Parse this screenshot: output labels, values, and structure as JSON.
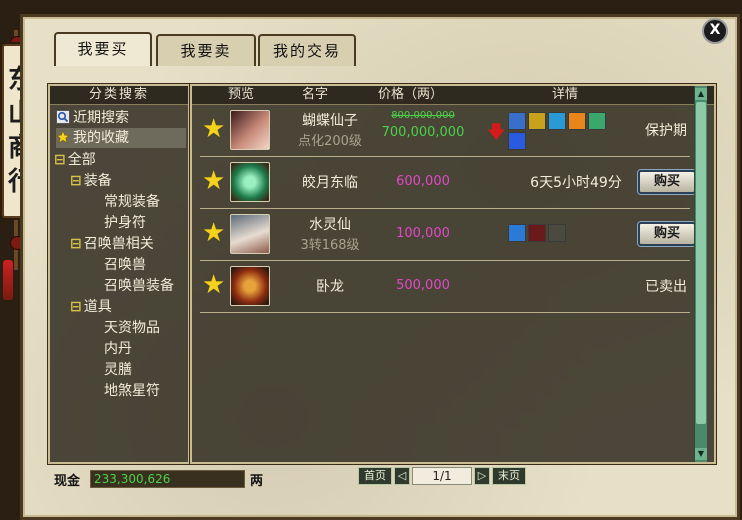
{
  "sign": {
    "chars": [
      "东",
      "山",
      "商",
      "行"
    ]
  },
  "close_label": "X",
  "tabs": [
    {
      "label": "我要买",
      "active": true
    },
    {
      "label": "我要卖",
      "active": false
    },
    {
      "label": "我的交易",
      "active": false
    }
  ],
  "left_panel": {
    "header": "分类搜索",
    "items": [
      {
        "label": "近期搜索",
        "icon": "search-icon"
      },
      {
        "label": "我的收藏",
        "icon": "star-icon",
        "selected": true
      },
      {
        "label": "全部",
        "expander": "⊟"
      },
      {
        "label": "装备",
        "expander": "⊟"
      },
      {
        "label": "常规装备"
      },
      {
        "label": "护身符"
      },
      {
        "label": "召唤兽相关",
        "expander": "⊟"
      },
      {
        "label": "召唤兽"
      },
      {
        "label": "召唤兽装备"
      },
      {
        "label": "道具",
        "expander": "⊟"
      },
      {
        "label": "天资物品"
      },
      {
        "label": "内丹"
      },
      {
        "label": "灵膳"
      },
      {
        "label": "地煞星符"
      }
    ]
  },
  "table": {
    "headers": {
      "preview": "预览",
      "name": "名字",
      "price": "价格（两）",
      "detail": "详情"
    },
    "rows": [
      {
        "name": "蝴蝶仙子",
        "sub": "点化200级",
        "old_price": "800,000,000",
        "price": "700,000,000",
        "price_color": "green",
        "price_down": true,
        "detail": "保护期"
      },
      {
        "name": "皎月东临",
        "sub": "",
        "price": "600,000",
        "detail": "6天5小时49分",
        "buy_label": "购买"
      },
      {
        "name": "水灵仙",
        "sub": "3转168级",
        "price": "100,000",
        "detail": "",
        "buy_label": "购买"
      },
      {
        "name": "卧龙",
        "sub": "",
        "price": "500,000",
        "detail": "已卖出"
      }
    ]
  },
  "footer": {
    "cash_label": "现金",
    "cash_value": "233,300,626",
    "cash_unit": "两",
    "first_page": "首页",
    "page_info": "1/1",
    "last_page": "末页"
  },
  "colors": {
    "price_pink": "#e04ac8",
    "price_green": "#4ad24a",
    "star": "#f5d21c"
  }
}
